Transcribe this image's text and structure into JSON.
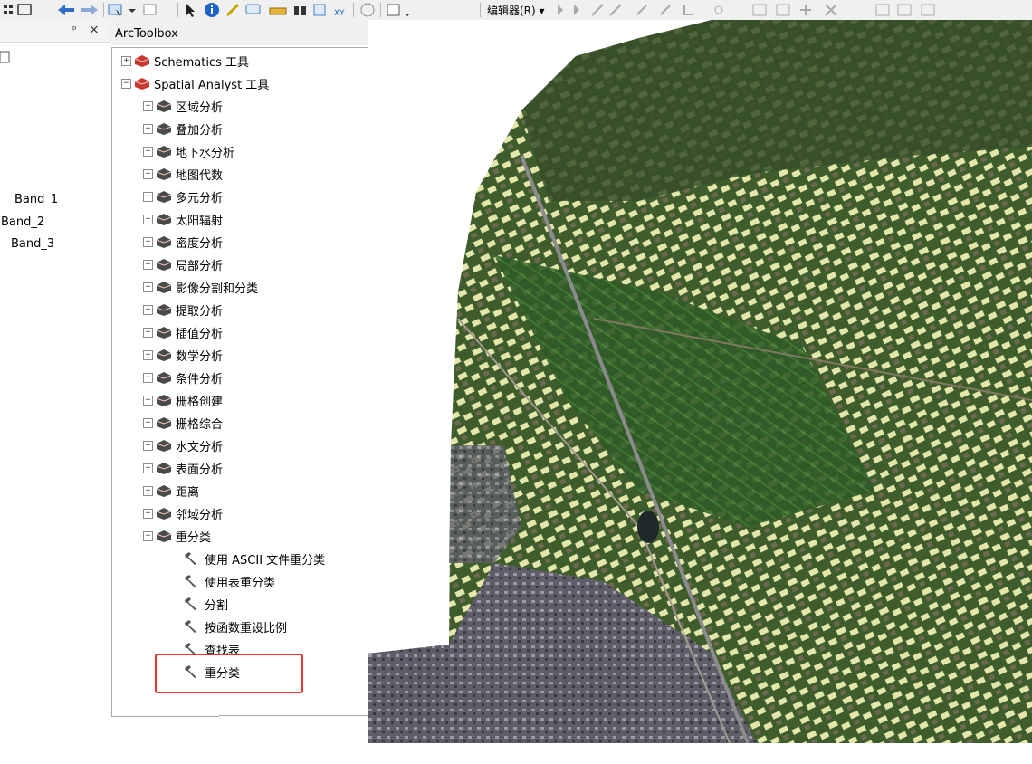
{
  "toolbar": {
    "editor_label": "编辑器(R) ▾"
  },
  "toc": {
    "pin_glyph": "ᵖ",
    "close_glyph": "×",
    "bands": [
      "Band_1",
      "Band_2",
      "Band_3"
    ]
  },
  "arctoolbox": {
    "title": "ArcToolbox",
    "window_glyphs": {
      "restore": "□",
      "close": "×"
    },
    "items": [
      {
        "label": "Schematics 工具",
        "level": 0,
        "expanded": false,
        "kind": "toolbox"
      },
      {
        "label": "Spatial Analyst 工具",
        "level": 0,
        "expanded": true,
        "kind": "toolbox"
      },
      {
        "label": "区域分析",
        "level": 1,
        "expanded": false,
        "kind": "toolset"
      },
      {
        "label": "叠加分析",
        "level": 1,
        "expanded": false,
        "kind": "toolset"
      },
      {
        "label": "地下水分析",
        "level": 1,
        "expanded": false,
        "kind": "toolset"
      },
      {
        "label": "地图代数",
        "level": 1,
        "expanded": false,
        "kind": "toolset"
      },
      {
        "label": "多元分析",
        "level": 1,
        "expanded": false,
        "kind": "toolset"
      },
      {
        "label": "太阳辐射",
        "level": 1,
        "expanded": false,
        "kind": "toolset"
      },
      {
        "label": "密度分析",
        "level": 1,
        "expanded": false,
        "kind": "toolset"
      },
      {
        "label": "局部分析",
        "level": 1,
        "expanded": false,
        "kind": "toolset"
      },
      {
        "label": "影像分割和分类",
        "level": 1,
        "expanded": false,
        "kind": "toolset"
      },
      {
        "label": "提取分析",
        "level": 1,
        "expanded": false,
        "kind": "toolset"
      },
      {
        "label": "插值分析",
        "level": 1,
        "expanded": false,
        "kind": "toolset"
      },
      {
        "label": "数学分析",
        "level": 1,
        "expanded": false,
        "kind": "toolset"
      },
      {
        "label": "条件分析",
        "level": 1,
        "expanded": false,
        "kind": "toolset"
      },
      {
        "label": "栅格创建",
        "level": 1,
        "expanded": false,
        "kind": "toolset"
      },
      {
        "label": "栅格综合",
        "level": 1,
        "expanded": false,
        "kind": "toolset"
      },
      {
        "label": "水文分析",
        "level": 1,
        "expanded": false,
        "kind": "toolset"
      },
      {
        "label": "表面分析",
        "level": 1,
        "expanded": false,
        "kind": "toolset"
      },
      {
        "label": "距离",
        "level": 1,
        "expanded": false,
        "kind": "toolset"
      },
      {
        "label": "邻域分析",
        "level": 1,
        "expanded": false,
        "kind": "toolset"
      },
      {
        "label": "重分类",
        "level": 1,
        "expanded": true,
        "kind": "toolset"
      },
      {
        "label": "使用 ASCII 文件重分类",
        "level": 2,
        "kind": "tool"
      },
      {
        "label": "使用表重分类",
        "level": 2,
        "kind": "tool"
      },
      {
        "label": "分割",
        "level": 2,
        "kind": "tool"
      },
      {
        "label": "按函数重设比例",
        "level": 2,
        "kind": "tool"
      },
      {
        "label": "查找表",
        "level": 2,
        "kind": "tool"
      },
      {
        "label": "重分类",
        "level": 2,
        "kind": "tool",
        "highlighted": true
      }
    ],
    "scroll_glyphs": {
      "up": "∧",
      "down": "∨"
    }
  },
  "icons": {
    "toolbox": "toolbox-icon",
    "toolset": "toolset-icon",
    "tool": "hammer-icon",
    "expand": "plus-box-icon",
    "collapse": "minus-box-icon"
  },
  "colors": {
    "highlight": "#e53333",
    "toolbox_red": "#c83a2f",
    "toolset_gray": "#4a4a4a",
    "field_light": "#e6eab0",
    "field_green": "#355a28",
    "urban": "#6b6a73"
  }
}
